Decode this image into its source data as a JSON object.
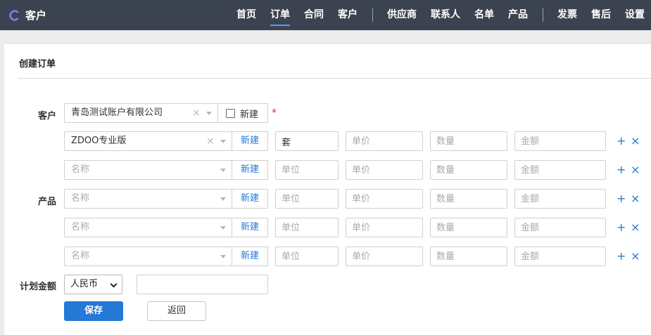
{
  "app": {
    "title": "客户",
    "accent": "#2478d6"
  },
  "nav": {
    "items": [
      "首页",
      "订单",
      "合同",
      "客户",
      "供应商",
      "联系人",
      "名单",
      "产品",
      "发票",
      "售后",
      "设置"
    ],
    "active_index": 1
  },
  "panel": {
    "title": "创建订单"
  },
  "form": {
    "customer": {
      "label": "客户",
      "value": "青岛测试账户有限公司",
      "clear_icon": "×",
      "new_checkbox_label": "新建",
      "required_mark": "*"
    },
    "product_label": "产品",
    "product_rows": [
      {
        "name": "ZDOO专业版",
        "name_placeholder": "名称",
        "new_label": "新建",
        "unit": "套",
        "unit_placeholder": "单位",
        "price_placeholder": "单价",
        "qty_placeholder": "数量",
        "amount_placeholder": "金额"
      },
      {
        "name": "",
        "name_placeholder": "名称",
        "new_label": "新建",
        "unit": "",
        "unit_placeholder": "单位",
        "price_placeholder": "单价",
        "qty_placeholder": "数量",
        "amount_placeholder": "金额"
      },
      {
        "name": "",
        "name_placeholder": "名称",
        "new_label": "新建",
        "unit": "",
        "unit_placeholder": "单位",
        "price_placeholder": "单价",
        "qty_placeholder": "数量",
        "amount_placeholder": "金额"
      },
      {
        "name": "",
        "name_placeholder": "名称",
        "new_label": "新建",
        "unit": "",
        "unit_placeholder": "单位",
        "price_placeholder": "单价",
        "qty_placeholder": "数量",
        "amount_placeholder": "金额"
      },
      {
        "name": "",
        "name_placeholder": "名称",
        "new_label": "新建",
        "unit": "",
        "unit_placeholder": "单位",
        "price_placeholder": "单价",
        "qty_placeholder": "数量",
        "amount_placeholder": "金额"
      }
    ],
    "row_add_icon": "+",
    "row_del_icon": "×",
    "plan_amount": {
      "label": "计划金额",
      "currency": "人民币",
      "amount": ""
    },
    "save_label": "保存",
    "back_label": "返回"
  }
}
